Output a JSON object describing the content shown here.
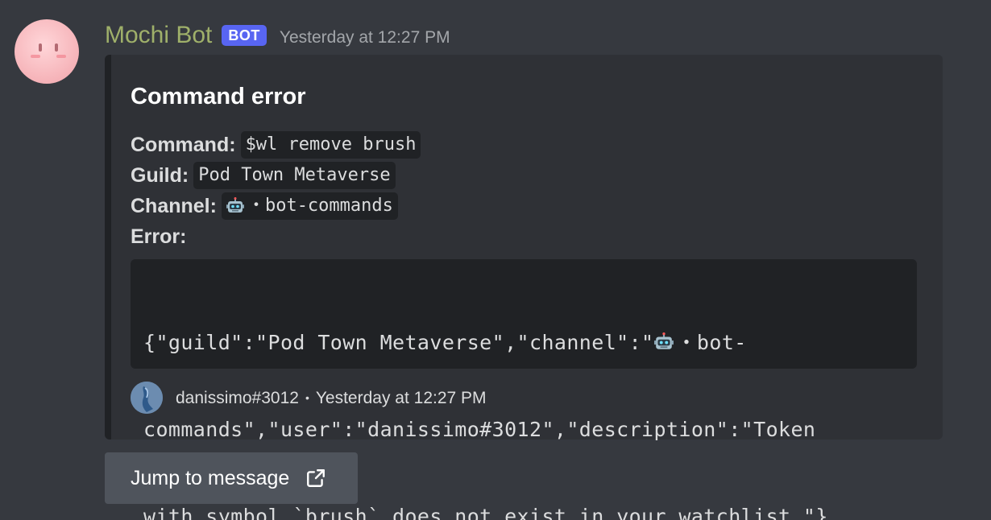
{
  "message": {
    "author": "Mochi Bot",
    "bot_tag": "BOT",
    "timestamp": "Yesterday at 12:27 PM"
  },
  "embed": {
    "title": "Command error",
    "fields": {
      "command_label": "Command:",
      "command_value": "$wl remove brush",
      "guild_label": "Guild:",
      "guild_value": "Pod Town Metaverse",
      "channel_label": "Channel:",
      "channel_value": "・bot-commands",
      "error_label": "Error:"
    },
    "error_lines": {
      "line1_a": "{\"guild\":\"Pod Town Metaverse\",\"channel\":\"",
      "line1_b": "・bot-",
      "line2": "commands\",\"user\":\"danissimo#3012\",\"description\":\"Token",
      "line3": "with symbol `brush` does not exist in your watchlist.\"}"
    },
    "footer": {
      "user": "danissimo#3012",
      "separator": "•",
      "timestamp": "Yesterday at 12:27 PM"
    }
  },
  "jump_button": {
    "label": "Jump to message",
    "icon": "external-link-icon"
  },
  "colors": {
    "background": "#36393f",
    "embed_background": "#2f3136",
    "embed_border": "#202225",
    "bot_tag": "#5865f2",
    "username": "#9fb06a",
    "button": "#4f545c"
  }
}
